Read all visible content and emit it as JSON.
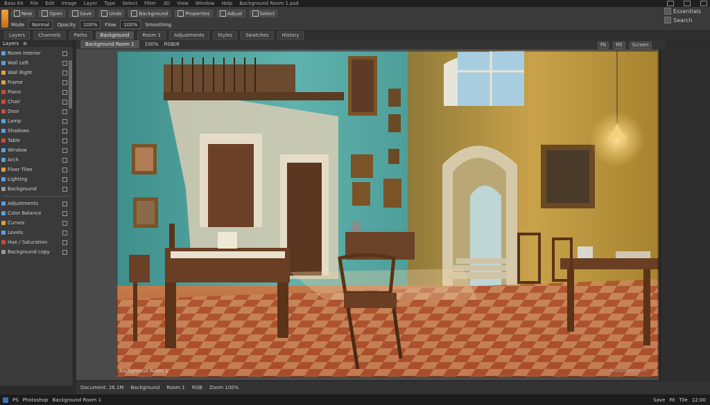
{
  "menubar": {
    "items": [
      "Bass 64",
      "File",
      "Edit",
      "Image",
      "Layer",
      "Type",
      "Select",
      "Filter",
      "3D",
      "View",
      "Window",
      "Help"
    ],
    "doc_path": "Background Room 1.psd"
  },
  "toolbar": {
    "row1": [
      "New",
      "Open",
      "Save",
      "Undo",
      "Background",
      "Properties",
      "Adjust",
      "Select"
    ],
    "row2": [
      "Mode",
      "Normal",
      "Opacity",
      "100%",
      "Flow",
      "100%",
      "Smoothing"
    ],
    "right_labels": [
      "Essentials",
      "Search"
    ]
  },
  "tabs": [
    "Layers",
    "Channels",
    "Paths",
    "Background",
    "Room 1",
    "Adjustments",
    "Styles",
    "Swatches",
    "History"
  ],
  "left_panel": {
    "title": "Layers",
    "items": [
      {
        "label": "Room Interior",
        "color": "#5aa0e0"
      },
      {
        "label": "Wall Left",
        "color": "#5aa0e0"
      },
      {
        "label": "Wall Right",
        "color": "#e0a040"
      },
      {
        "label": "Frame",
        "color": "#e0a040"
      },
      {
        "label": "Piano",
        "color": "#d04a3a"
      },
      {
        "label": "Chair",
        "color": "#d04a3a"
      },
      {
        "label": "Door",
        "color": "#d04a3a"
      },
      {
        "label": "Lamp",
        "color": "#5aa0e0"
      },
      {
        "label": "Shadows",
        "color": "#5aa0e0"
      },
      {
        "label": "Table",
        "color": "#d04a3a"
      },
      {
        "label": "Window",
        "color": "#5aa0e0"
      },
      {
        "label": "Arch",
        "color": "#5aa0e0"
      },
      {
        "label": "Floor Tiles",
        "color": "#e0a040"
      },
      {
        "label": "Lighting",
        "color": "#5aa0e0"
      },
      {
        "label": "Background",
        "color": "#999999"
      },
      {
        "label": "Adjustments",
        "color": "#5aa0e0"
      },
      {
        "label": "Color Balance",
        "color": "#5aa0e0"
      },
      {
        "label": "Curves",
        "color": "#e0a040"
      },
      {
        "label": "Levels",
        "color": "#5aa0e0"
      },
      {
        "label": "Hue / Saturation",
        "color": "#d04a3a"
      },
      {
        "label": "Background copy",
        "color": "#999999"
      }
    ]
  },
  "doc": {
    "tab_label": "Background Room 1",
    "zoom": "100%",
    "mode": "RGB/8",
    "right": [
      "Fit",
      "Fill",
      "Screen"
    ]
  },
  "canvas_caption": "Background Room 1",
  "canvas_caption_right": "background room",
  "statusbar": [
    "Document: 26.1M",
    "Background",
    "Room 1",
    "RGB",
    "Zoom 100%"
  ],
  "taskbar": {
    "app": "PS",
    "items": [
      "Photoshop",
      "Background Room 1"
    ],
    "right": [
      "Save",
      "Fit",
      "Tile"
    ],
    "clock": "12:00"
  }
}
